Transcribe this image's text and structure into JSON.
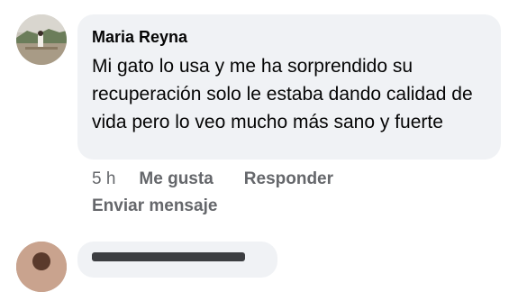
{
  "comment": {
    "author": "Maria Reyna",
    "text": "Mi gato lo usa y me ha sorprendido su recuperación solo le estaba dando calidad de vida pero lo veo mucho más sano y fuerte",
    "time": "5 h",
    "like_label": "Me gusta",
    "reply_label": "Responder",
    "send_message_label": "Enviar mensaje"
  },
  "next_comment": {
    "author_icon": "avatar"
  },
  "colors": {
    "bubble_bg": "#f0f2f5",
    "text": "#050505",
    "secondary_text": "#65676b"
  }
}
